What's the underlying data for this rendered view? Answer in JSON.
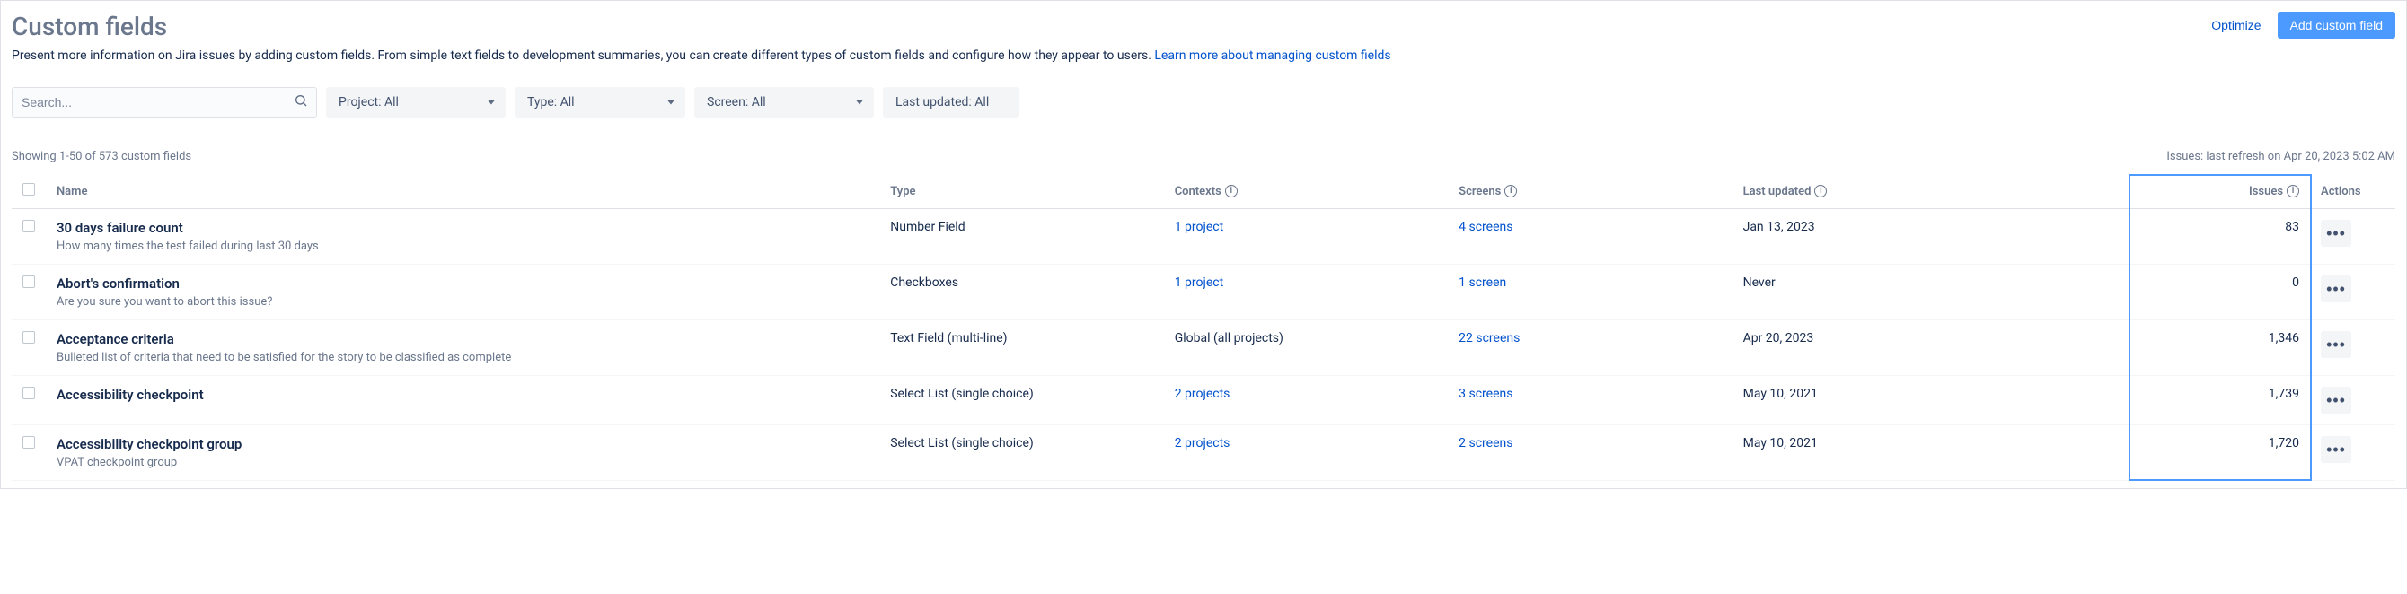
{
  "header": {
    "title": "Custom fields",
    "optimize": "Optimize",
    "add": "Add custom field"
  },
  "description": {
    "text": "Present more information on Jira issues by adding custom fields. From simple text fields to development summaries, you can create different types of custom fields and configure how they appear to users. ",
    "link": "Learn more about managing custom fields"
  },
  "search": {
    "placeholder": "Search..."
  },
  "filters": {
    "project": "Project: All",
    "type": "Type: All",
    "screen": "Screen: All",
    "last_updated": "Last updated: All"
  },
  "meta": {
    "showing": "Showing 1-50 of 573 custom fields",
    "refresh": "Issues: last refresh on Apr 20, 2023 5:02 AM"
  },
  "columns": {
    "name": "Name",
    "type": "Type",
    "contexts": "Contexts",
    "screens": "Screens",
    "last_updated": "Last updated",
    "issues": "Issues",
    "actions": "Actions"
  },
  "rows": [
    {
      "name": "30 days failure count",
      "desc": "How many times the test failed during last 30 days",
      "type": "Number Field",
      "contexts": "1 project",
      "contexts_link": true,
      "screens": "4 screens",
      "last_updated": "Jan 13, 2023",
      "issues": "83"
    },
    {
      "name": "Abort's confirmation",
      "desc": "Are you sure you want to abort this issue?",
      "type": "Checkboxes",
      "contexts": "1 project",
      "contexts_link": true,
      "screens": "1 screen",
      "last_updated": "Never",
      "issues": "0"
    },
    {
      "name": "Acceptance criteria",
      "desc": "Bulleted list of criteria that need to be satisfied for the story to be classified as complete",
      "type": "Text Field (multi-line)",
      "contexts": "Global (all projects)",
      "contexts_link": false,
      "screens": "22 screens",
      "last_updated": "Apr 20, 2023",
      "issues": "1,346"
    },
    {
      "name": "Accessibility checkpoint",
      "desc": "",
      "type": "Select List (single choice)",
      "contexts": "2 projects",
      "contexts_link": true,
      "screens": "3 screens",
      "last_updated": "May 10, 2021",
      "issues": "1,739"
    },
    {
      "name": "Accessibility checkpoint group",
      "desc": "VPAT checkpoint group",
      "type": "Select List (single choice)",
      "contexts": "2 projects",
      "contexts_link": true,
      "screens": "2 screens",
      "last_updated": "May 10, 2021",
      "issues": "1,720"
    }
  ]
}
